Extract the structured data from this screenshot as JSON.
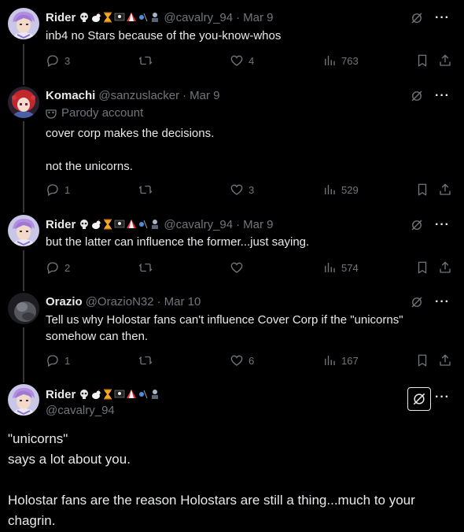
{
  "tweets": [
    {
      "name": "Rider",
      "handle": "@cavalry_94",
      "date": "Mar 9",
      "text": "inb4 no Stars because of the you-know-whos",
      "replies": "3",
      "retweets": "",
      "likes": "4",
      "views": "763"
    },
    {
      "name": "Komachi",
      "handle": "@sanzuslacker",
      "date": "Mar 9",
      "parody_label": "Parody account",
      "text": "cover corp makes the decisions.\n\nnot the unicorns.",
      "replies": "1",
      "retweets": "",
      "likes": "3",
      "views": "529"
    },
    {
      "name": "Rider",
      "handle": "@cavalry_94",
      "date": "Mar 9",
      "text": "but the latter can influence the former...just saying.",
      "replies": "2",
      "retweets": "",
      "likes": "",
      "views": "574"
    },
    {
      "name": "Orazio",
      "handle": "@OrazioN32",
      "date": "Mar 10",
      "text": "Tell us why Holostar fans can't influence Cover Corp if the \"unicorns\"\nsomehow can then.",
      "replies": "1",
      "retweets": "",
      "likes": "6",
      "views": "167"
    }
  ],
  "focus": {
    "name": "Rider",
    "handle": "@cavalry_94",
    "text": "\"unicorns\"\nsays a lot about you.\n\nHolostar fans are the reason Holostars are still a thing...much to your\nchagrin."
  },
  "separator": "·",
  "icons": {
    "more": "more-icon",
    "grok": "grok-icon",
    "reply": "reply-icon",
    "retweet": "retweet-icon",
    "like": "like-icon",
    "views": "views-icon",
    "bookmark": "bookmark-icon",
    "share": "share-icon"
  },
  "colors": {
    "background": "#000000",
    "text": "#e7e9ea",
    "muted": "#71767b",
    "thread_line": "#333639"
  }
}
